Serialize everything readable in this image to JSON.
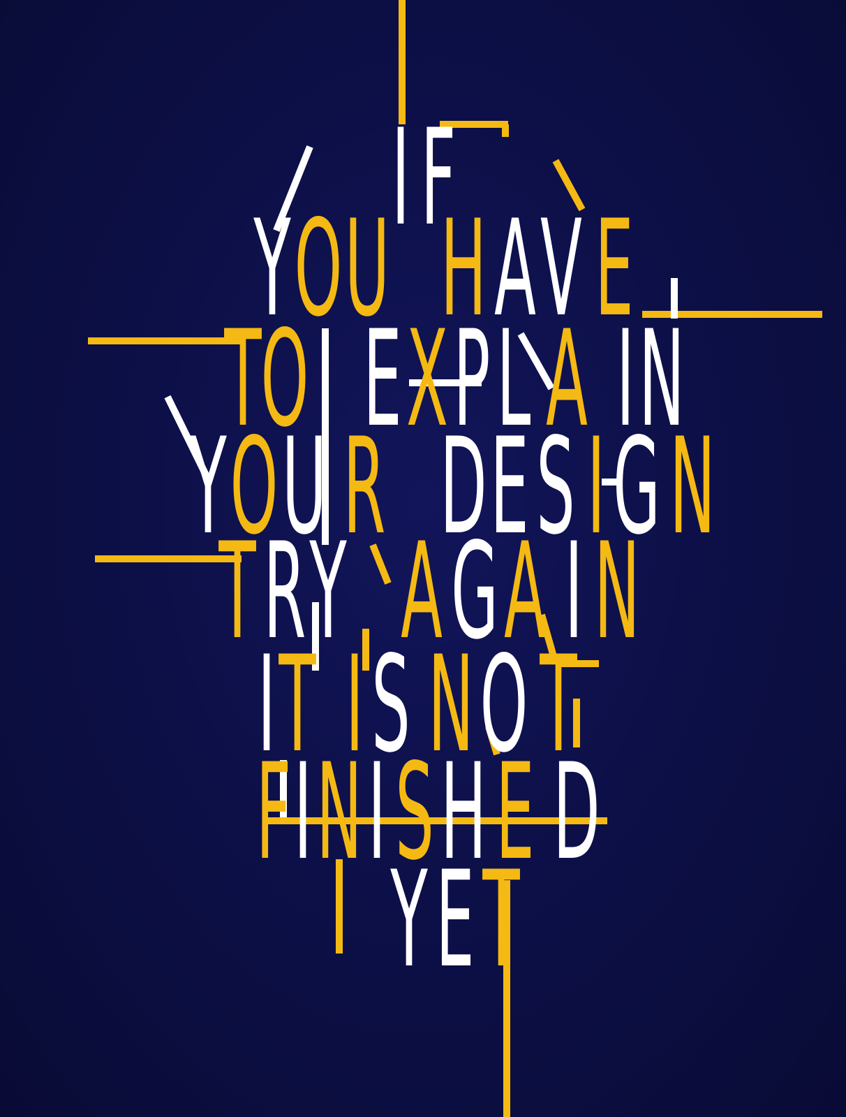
{
  "poster": {
    "background_color": "#0b0d3a",
    "accent_color": "#f5b914",
    "text_color": "#ffffff",
    "quote_lines": [
      "IF",
      "YOU HAVE",
      "TO EXPLAIN",
      "YOUR DESIGN",
      "TRY AGAIN",
      "IT IS NOT",
      "FINISHED",
      "YET"
    ],
    "letters": [
      {
        "ch": "I",
        "color": "white"
      },
      {
        "ch": "F",
        "color": "white"
      },
      {
        "ch": "Y",
        "color": "white"
      },
      {
        "ch": "O",
        "color": "yellow"
      },
      {
        "ch": "U",
        "color": "yellow"
      },
      {
        "ch": "H",
        "color": "yellow"
      },
      {
        "ch": "A",
        "color": "white"
      },
      {
        "ch": "V",
        "color": "white"
      },
      {
        "ch": "E",
        "color": "yellow"
      },
      {
        "ch": "T",
        "color": "yellow"
      },
      {
        "ch": "O",
        "color": "yellow"
      },
      {
        "ch": "E",
        "color": "white"
      },
      {
        "ch": "X",
        "color": "yellow"
      },
      {
        "ch": "P",
        "color": "white"
      },
      {
        "ch": "L",
        "color": "white"
      },
      {
        "ch": "A",
        "color": "yellow"
      },
      {
        "ch": "I",
        "color": "white"
      },
      {
        "ch": "N",
        "color": "white"
      },
      {
        "ch": "Y",
        "color": "white"
      },
      {
        "ch": "O",
        "color": "yellow"
      },
      {
        "ch": "U",
        "color": "white"
      },
      {
        "ch": "R",
        "color": "yellow"
      },
      {
        "ch": "D",
        "color": "white"
      },
      {
        "ch": "E",
        "color": "white"
      },
      {
        "ch": "S",
        "color": "white"
      },
      {
        "ch": "I",
        "color": "yellow"
      },
      {
        "ch": "G",
        "color": "white"
      },
      {
        "ch": "N",
        "color": "yellow"
      },
      {
        "ch": "T",
        "color": "yellow"
      },
      {
        "ch": "R",
        "color": "white"
      },
      {
        "ch": "Y",
        "color": "white"
      },
      {
        "ch": "A",
        "color": "yellow"
      },
      {
        "ch": "G",
        "color": "white"
      },
      {
        "ch": "A",
        "color": "yellow"
      },
      {
        "ch": "I",
        "color": "white"
      },
      {
        "ch": "N",
        "color": "yellow"
      },
      {
        "ch": "I",
        "color": "white"
      },
      {
        "ch": "T",
        "color": "yellow"
      },
      {
        "ch": "I",
        "color": "yellow"
      },
      {
        "ch": "S",
        "color": "white"
      },
      {
        "ch": "N",
        "color": "yellow"
      },
      {
        "ch": "O",
        "color": "white"
      },
      {
        "ch": "T",
        "color": "yellow"
      },
      {
        "ch": "F",
        "color": "yellow"
      },
      {
        "ch": "I",
        "color": "white"
      },
      {
        "ch": "N",
        "color": "yellow"
      },
      {
        "ch": "I",
        "color": "white"
      },
      {
        "ch": "S",
        "color": "yellow"
      },
      {
        "ch": "H",
        "color": "white"
      },
      {
        "ch": "E",
        "color": "yellow"
      },
      {
        "ch": "D",
        "color": "white"
      },
      {
        "ch": "Y",
        "color": "white"
      },
      {
        "ch": "E",
        "color": "white"
      },
      {
        "ch": "T",
        "color": "yellow"
      }
    ]
  }
}
